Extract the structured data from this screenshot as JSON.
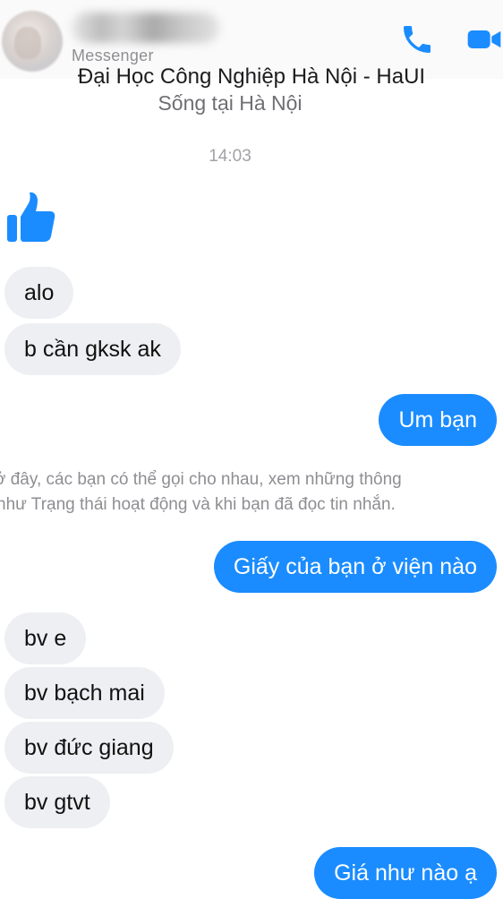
{
  "header": {
    "app_label": "Messenger",
    "page_line": "Đại Học Công Nghiệp Hà Nội - HaUI",
    "location": "Sống tại Hà Nội",
    "call_icon": "phone-icon",
    "video_icon": "video-camera-icon",
    "accent_color": "#1a8cff"
  },
  "chat": {
    "timestamp": "14:03",
    "like_icon": "thumbs-up-icon",
    "notice_line1": "ở đây, các bạn có thể gọi cho nhau, xem những thông",
    "notice_line2": "như Trạng thái hoạt động và khi bạn đã đọc tin nhắn.",
    "messages": [
      {
        "from": "them",
        "text": "alo"
      },
      {
        "from": "them",
        "text": "b cần gksk ak"
      },
      {
        "from": "me",
        "text": "Um bạn"
      },
      {
        "from": "me",
        "text": "Giấy của bạn ở viện nào"
      },
      {
        "from": "them",
        "text": "bv e"
      },
      {
        "from": "them",
        "text": "bv bạch mai"
      },
      {
        "from": "them",
        "text": "bv đức giang"
      },
      {
        "from": "them",
        "text": "bv gtvt"
      },
      {
        "from": "me",
        "text": "Giá như nào ạ"
      }
    ]
  }
}
